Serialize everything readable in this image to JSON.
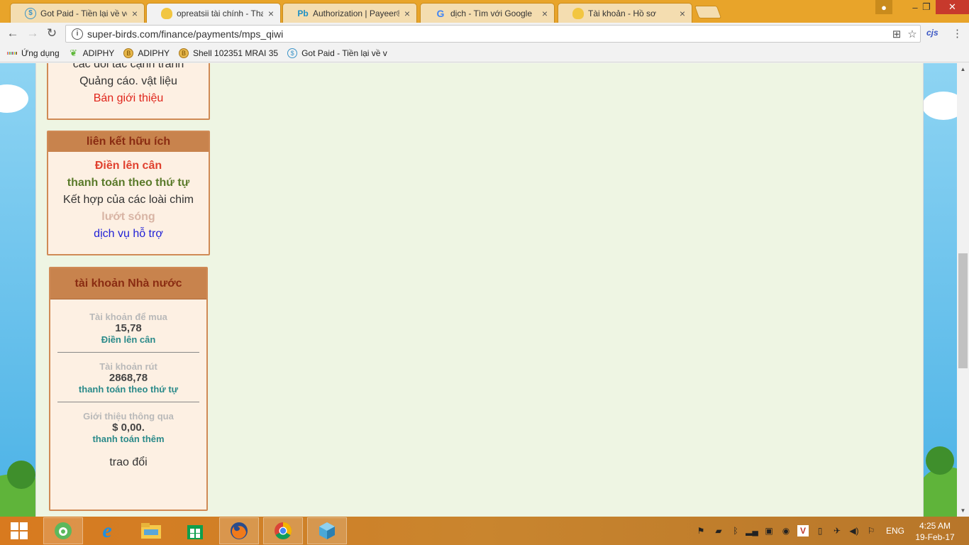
{
  "browser": {
    "tabs": [
      {
        "title": "Got Paid - Tiền lại về với",
        "icon": "dollar-circle-icon",
        "active": false
      },
      {
        "title": "opreatsii tài chính - Than",
        "icon": "bird-icon",
        "active": true
      },
      {
        "title": "Authorization | Payeer®",
        "icon": "payeer-icon",
        "active": false
      },
      {
        "title": "dịch - Tìm với Google",
        "icon": "google-icon",
        "active": false
      },
      {
        "title": "Tài khoản - Hồ sơ",
        "icon": "bird-icon",
        "active": false
      }
    ],
    "url": "super-birds.com/finance/payments/mps_qiwi",
    "extension_label": "cjs",
    "bookmarks": [
      {
        "label": "Ứng dụng",
        "icon": "apps-grid-icon"
      },
      {
        "label": "ADIPHY",
        "icon": "leaf-icon"
      },
      {
        "label": "ADIPHY",
        "icon": "coin-icon"
      },
      {
        "label": "Shell 102351 MRAI 35",
        "icon": "coin-icon"
      },
      {
        "label": "Got Paid - Tiền lại về v",
        "icon": "dollar-circle-icon"
      }
    ]
  },
  "sidebar": {
    "box1": {
      "lines": [
        {
          "text": "các đối tác cạnh tranh",
          "color": "#333333"
        },
        {
          "text": "Quảng cáo. vật liệu",
          "color": "#333333"
        },
        {
          "text": "Bán giới thiệu",
          "color": "#e0251b"
        }
      ]
    },
    "links_box": {
      "title": "liên kết hữu ích",
      "items": [
        {
          "text": "Điền lên cân",
          "color": "#e0412f",
          "bold": true
        },
        {
          "text": "thanh toán theo thứ tự",
          "color": "#5a7a2a",
          "bold": true
        },
        {
          "text": "Kết hợp của các loài chim",
          "color": "#333333",
          "bold": false
        },
        {
          "text": "lướt sóng",
          "color": "#d8b4a4",
          "bold": true
        },
        {
          "text": "dịch vụ hỗ trợ",
          "color": "#1f1fd6",
          "bold": false
        }
      ]
    },
    "account_box": {
      "title": "tài khoản Nhà nước",
      "sections": [
        {
          "label": "Tài khoản để mua",
          "value": "15,78",
          "link": "Điền lên cân"
        },
        {
          "label": "Tài khoản rút",
          "value": "2868,78",
          "link": "thanh toán theo thứ tự"
        },
        {
          "label": "Giới thiệu thông qua",
          "value": "$ 0,00.",
          "link": "thanh toán thêm"
        }
      ],
      "footer": "trao đổi"
    }
  },
  "taskbar": {
    "language": "ENG",
    "time": "4:25 AM",
    "date": "19-Feb-17"
  }
}
